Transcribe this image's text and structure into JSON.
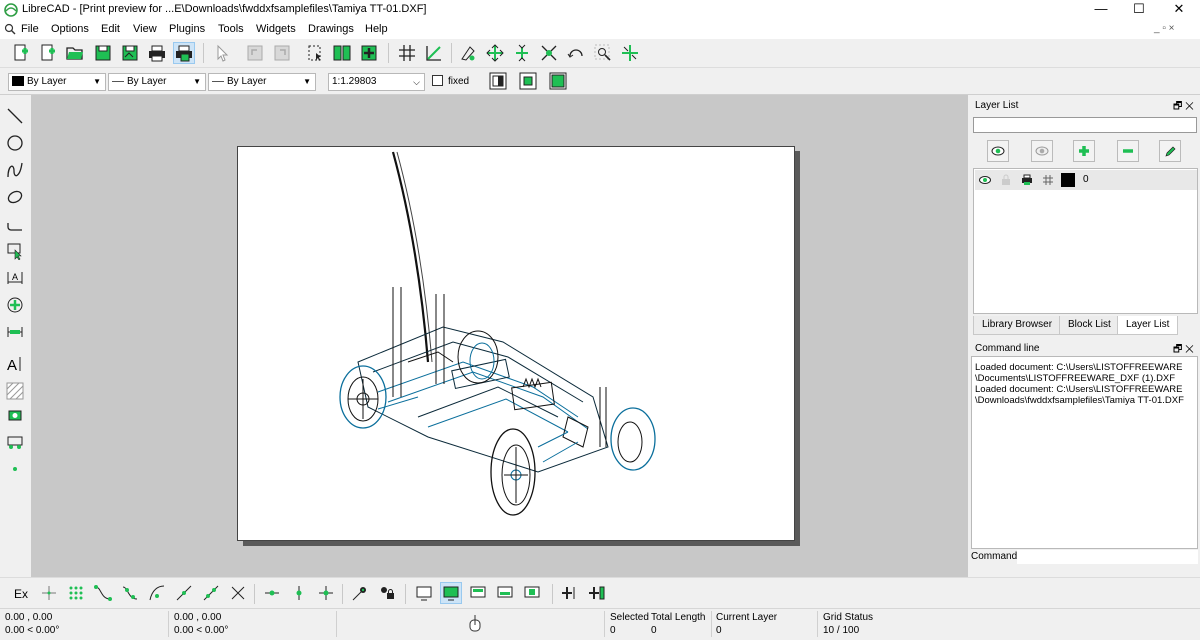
{
  "window": {
    "title": "LibreCAD - [Print preview for ...E\\Downloads\\fwddxfsamplefiles\\Tamiya TT-01.DXF]",
    "minimize": "—",
    "maximize": "☐",
    "close": "✕"
  },
  "menu": {
    "items": [
      "File",
      "Options",
      "Edit",
      "View",
      "Plugins",
      "Tools",
      "Widgets",
      "Drawings",
      "Help"
    ],
    "mdi_controls": "_ ▫ ×"
  },
  "pen_toolbar": {
    "color": "By Layer",
    "width": "By Layer",
    "linetype": "By Layer",
    "scale": "1:1.29803",
    "fixed_label": "fixed"
  },
  "layer_list": {
    "title": "Layer List",
    "filter_placeholder": "",
    "layers": [
      {
        "name": "0",
        "color": "#000000"
      }
    ]
  },
  "dock_tabs": [
    "Library Browser",
    "Block List",
    "Layer List"
  ],
  "command_line": {
    "title": "Command line",
    "output": [
      "Loaded document: C:\\Users\\LISTOFFREEWARE",
      "\\Documents\\LISTOFFREEWARE_DXF (1).DXF",
      "Loaded document: C:\\Users\\LISTOFFREEWARE",
      "\\Downloads\\fwddxfsamplefiles\\Tamiya TT-01.DXF"
    ],
    "prompt": "Command:"
  },
  "snap_toolbar": {
    "ex_label": "Ex"
  },
  "status": {
    "coord_abs_1": "0.00 , 0.00",
    "coord_abs_2": "0.00 < 0.00°",
    "coord_rel_1": "0.00 , 0.00",
    "coord_rel_2": "0.00 < 0.00°",
    "selected_label": "Selected",
    "selected_value": "0",
    "total_length_label": "Total Length",
    "total_length_value": "0",
    "current_layer_label": "Current Layer",
    "current_layer_value": "0",
    "grid_status_label": "Grid Status",
    "grid_status_value": "10 / 100"
  },
  "colors": {
    "accent_green": "#1fbf54",
    "drawing_blue": "#0b6f9c",
    "canvas_bg": "#c8c8c8"
  }
}
